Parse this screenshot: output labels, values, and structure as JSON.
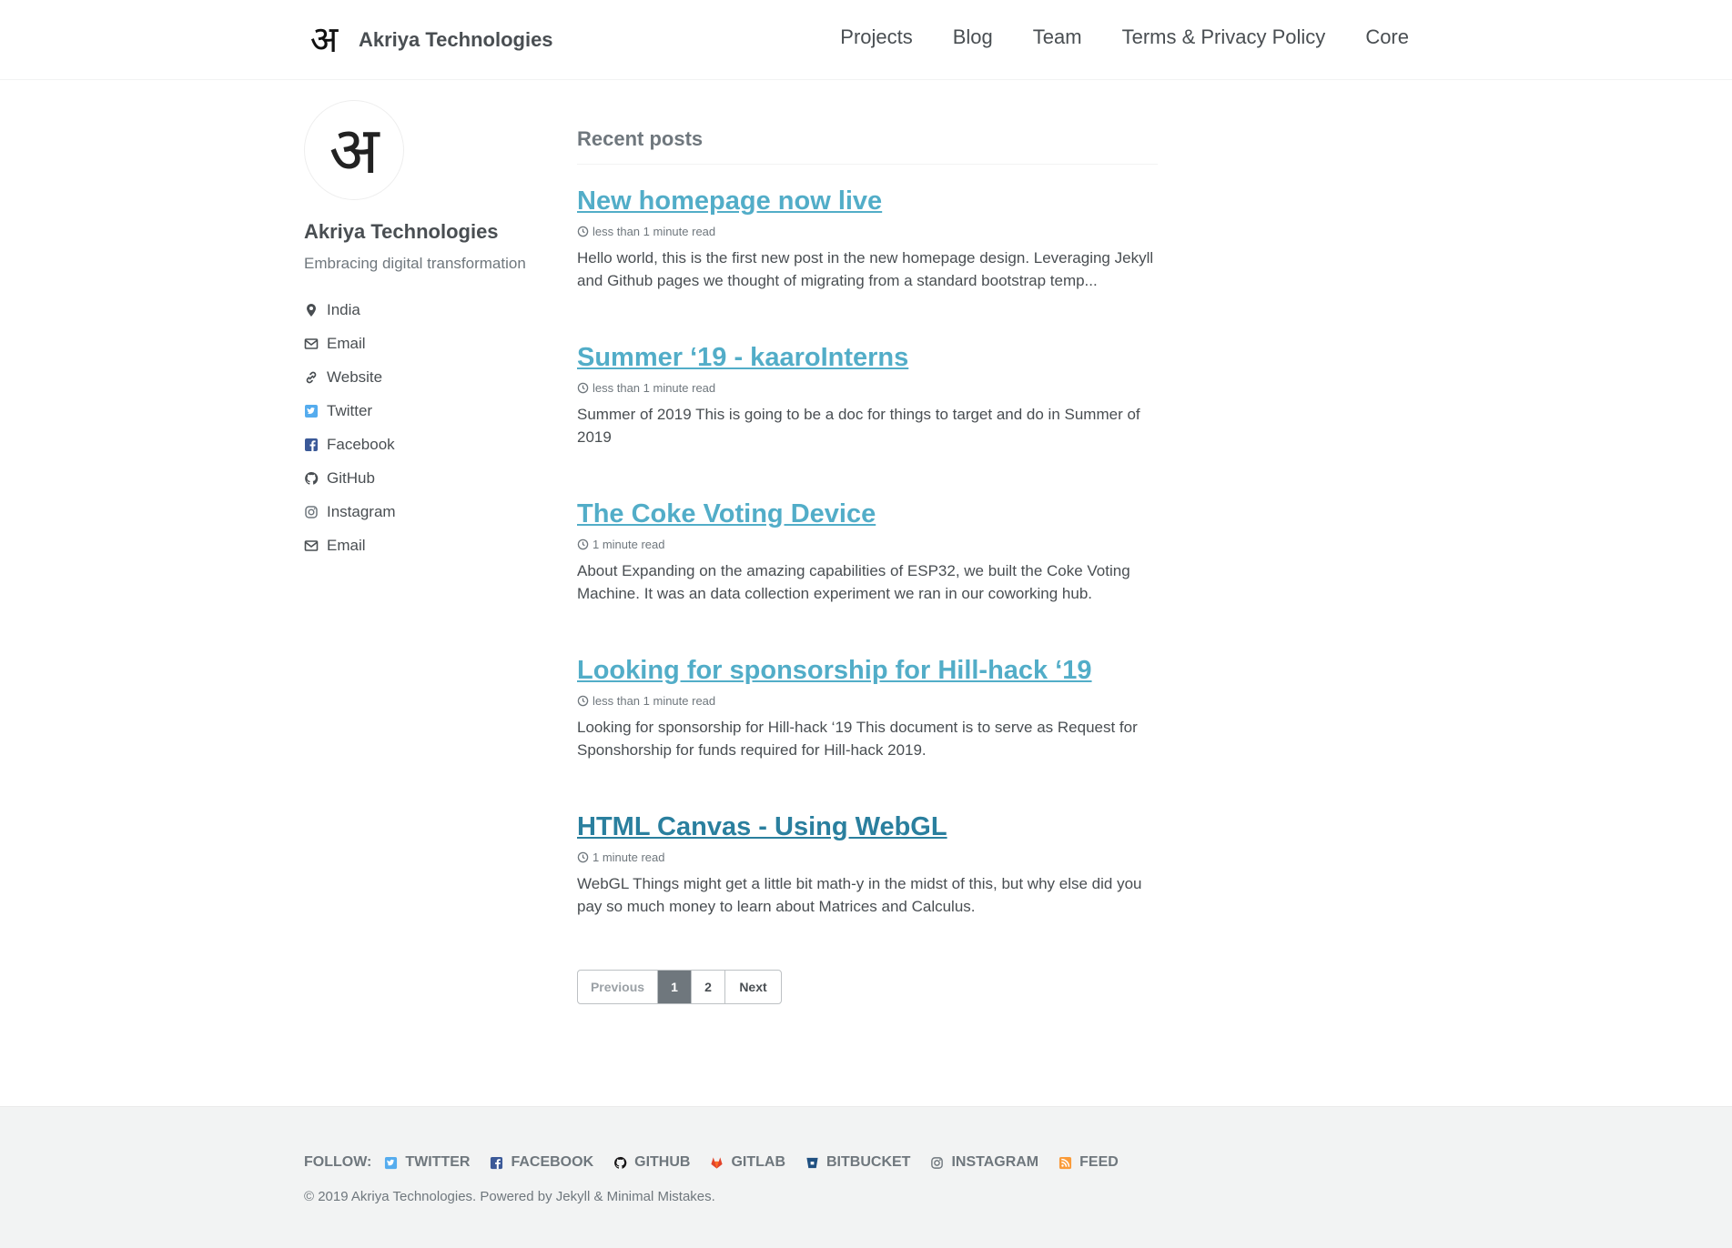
{
  "header": {
    "logo_glyph": "अ",
    "site_title": "Akriya Technologies",
    "nav": [
      "Projects",
      "Blog",
      "Team",
      "Terms & Privacy Policy",
      "Core"
    ]
  },
  "sidebar": {
    "avatar_glyph": "अ",
    "name": "Akriya Technologies",
    "bio": "Embracing digital transformation",
    "links": [
      {
        "label": "India",
        "icon": "map-marker-icon"
      },
      {
        "label": "Email",
        "icon": "envelope-icon"
      },
      {
        "label": "Website",
        "icon": "link-icon"
      },
      {
        "label": "Twitter",
        "icon": "twitter-icon"
      },
      {
        "label": "Facebook",
        "icon": "facebook-icon"
      },
      {
        "label": "GitHub",
        "icon": "github-icon"
      },
      {
        "label": "Instagram",
        "icon": "instagram-icon"
      },
      {
        "label": "Email",
        "icon": "envelope-icon"
      }
    ]
  },
  "main": {
    "section_title": "Recent posts",
    "posts": [
      {
        "title": "New homepage now live",
        "meta": "less than 1 minute read",
        "excerpt": "Hello world, this is the first new post in the new homepage design. Leveraging Jekyll and Github pages we thought of migrating from a standard bootstrap temp..."
      },
      {
        "title": "Summer ‘19 - kaaroInterns",
        "meta": "less than 1 minute read",
        "excerpt": "Summer of 2019 This is going to be a doc for things to target and do in Summer of 2019"
      },
      {
        "title": "The Coke Voting Device",
        "meta": "1 minute read",
        "excerpt": "About Expanding on the amazing capabilities of ESP32, we built the Coke Voting Machine. It was an data collection experiment we ran in our coworking hub."
      },
      {
        "title": "Looking for sponsorship for Hill-hack ‘19",
        "meta": "less than 1 minute read",
        "excerpt": "Looking for sponsorship for Hill-hack ‘19 This document is to serve as Request for Sponshorship for funds required for Hill-hack 2019."
      },
      {
        "title": "HTML Canvas  - Using WebGL",
        "meta": "1 minute read",
        "excerpt": "WebGL Things might get a little bit math-y in the midst of this, but why else did you pay so much money to learn about Matrices and Calculus."
      }
    ],
    "pagination": {
      "previous": "Previous",
      "pages": [
        "1",
        "2"
      ],
      "current": "1",
      "next": "Next"
    }
  },
  "footer": {
    "follow_label": "FOLLOW:",
    "links": [
      {
        "label": "TWITTER",
        "icon": "twitter-icon",
        "color": "#55acee"
      },
      {
        "label": "FACEBOOK",
        "icon": "facebook-icon",
        "color": "#3b5998"
      },
      {
        "label": "GITHUB",
        "icon": "github-icon",
        "color": "#171516"
      },
      {
        "label": "GITLAB",
        "icon": "gitlab-icon",
        "color": "#e2432a"
      },
      {
        "label": "BITBUCKET",
        "icon": "bitbucket-icon",
        "color": "#205081"
      },
      {
        "label": "INSTAGRAM",
        "icon": "instagram-icon",
        "color": "#6f777d"
      },
      {
        "label": "FEED",
        "icon": "rss-icon",
        "color": "#fa9b39"
      }
    ],
    "copyright": "© 2019 Akriya Technologies. Powered by Jekyll & Minimal Mistakes."
  },
  "colors": {
    "link": "#52adc8",
    "text": "#494e52",
    "muted": "#6f777d",
    "footer_bg": "#f2f3f3"
  }
}
